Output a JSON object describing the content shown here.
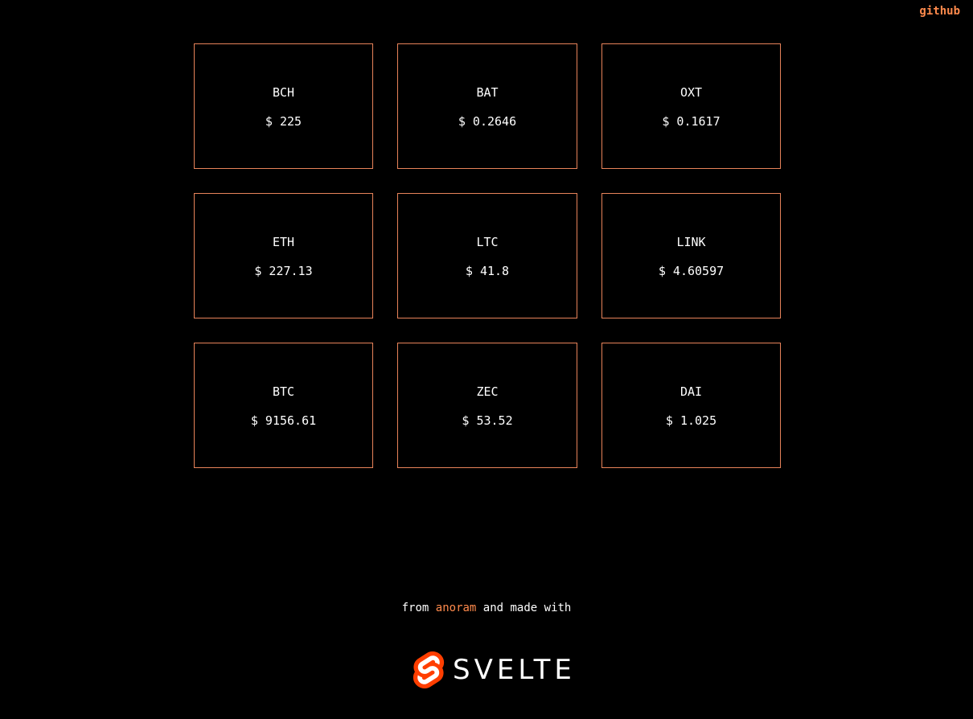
{
  "header": {
    "github_label": "github"
  },
  "coins": [
    {
      "symbol": "BCH",
      "price": "$ 225"
    },
    {
      "symbol": "BAT",
      "price": "$ 0.2646"
    },
    {
      "symbol": "OXT",
      "price": "$ 0.1617"
    },
    {
      "symbol": "ETH",
      "price": "$ 227.13"
    },
    {
      "symbol": "LTC",
      "price": "$ 41.8"
    },
    {
      "symbol": "LINK",
      "price": "$ 4.60597"
    },
    {
      "symbol": "BTC",
      "price": "$ 9156.61"
    },
    {
      "symbol": "ZEC",
      "price": "$ 53.52"
    },
    {
      "symbol": "DAI",
      "price": "$ 1.025"
    }
  ],
  "footer": {
    "prefix": "from ",
    "author": "anoram",
    "suffix": " and made with",
    "brand": "SVELTE",
    "brand_icon": "svelte-logo-icon"
  },
  "colors": {
    "background": "#000000",
    "accent": "#ff8a4c",
    "card_border": "#e8835a",
    "svelte": "#ff3e00"
  }
}
